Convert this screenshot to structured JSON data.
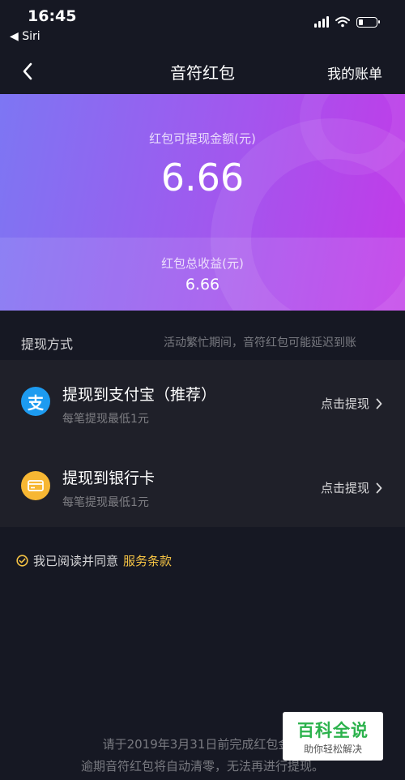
{
  "status_bar": {
    "time": "16:45",
    "back_app": "◀ Siri"
  },
  "nav": {
    "title": "音符红包",
    "right_label": "我的账单"
  },
  "hero": {
    "available_label": "红包可提现金额(元)",
    "available_amount": "6.66",
    "total_label": "红包总收益(元)",
    "total_amount": "6.66"
  },
  "withdraw": {
    "section_title": "提现方式",
    "notice": "活动繁忙期间，音符红包可能延迟到账",
    "methods": [
      {
        "name": "提现到支付宝（推荐）",
        "sub": "每笔提现最低1元",
        "action": "点击提现",
        "icon": "alipay-icon",
        "icon_glyph": "支",
        "icon_color": "#1d9bf0"
      },
      {
        "name": "提现到银行卡",
        "sub": "每笔提现最低1元",
        "action": "点击提现",
        "icon": "bank-card-icon",
        "icon_color": "#f7b733"
      }
    ]
  },
  "agreement": {
    "prefix": "我已阅读并同意",
    "link": "服务条款"
  },
  "footer": {
    "line1": "请于2019年3月31日前完成红包金额",
    "line2": "逾期音符红包将自动清零，无法再进行提现。"
  },
  "watermark": {
    "title": "百科全说",
    "subtitle": "助你轻松解决"
  },
  "colors": {
    "background": "#161823",
    "panel": "#1f2029",
    "accent": "#f5c344",
    "gradient_start": "#7d76f3",
    "gradient_end": "#c23ae8"
  }
}
